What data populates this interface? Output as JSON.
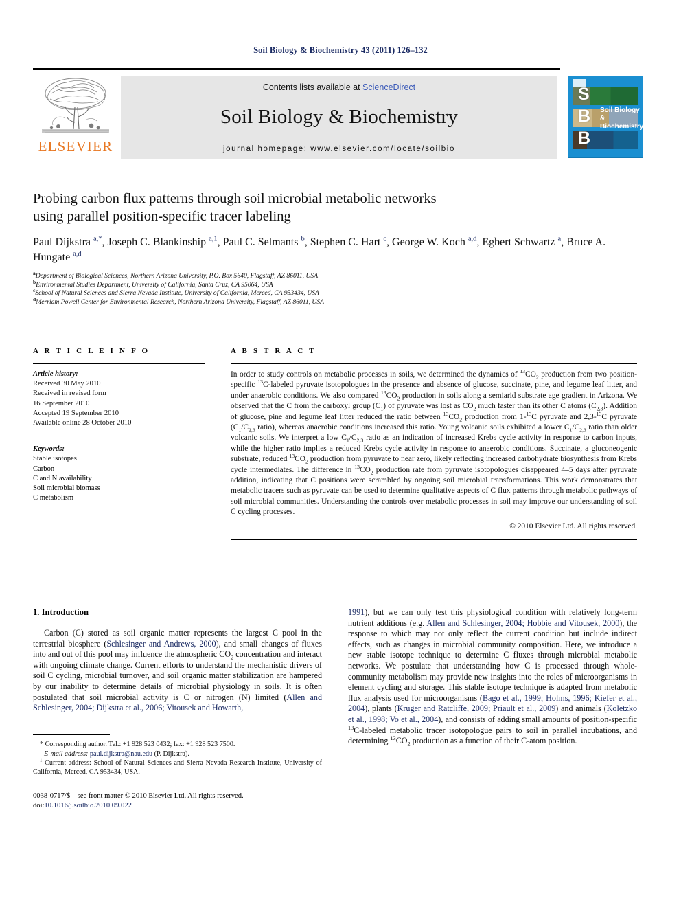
{
  "running_head": "Soil Biology & Biochemistry 43 (2011) 126–132",
  "masthead": {
    "contents_prefix": "Contents lists available at ",
    "sciencedirect": "ScienceDirect",
    "journal_title": "Soil Biology & Biochemistry",
    "homepage": "journal homepage: www.elsevier.com/locate/soilbio",
    "publisher_wordmark": "ELSEVIER",
    "cover": {
      "letters": "S\nB\nB",
      "title_line1": "Soil Biology &",
      "title_line2": "Biochemistry"
    },
    "accent_orange": "#e87722",
    "link_blue": "#3b5ab8",
    "cover_blue": "#1a8fd1"
  },
  "article": {
    "title_line1": "Probing carbon flux patterns through soil microbial metabolic networks",
    "title_line2": "using parallel position-specific tracer labeling",
    "authors_html": "Paul Dijkstra <sup>a,*</sup>, Joseph C. Blankinship <sup>a,1</sup>, Paul C. Selmants <sup>b</sup>, Stephen C. Hart <sup>c</sup>, George W. Koch <sup>a,d</sup>, Egbert Schwartz <sup>a</sup>, Bruce A. Hungate <sup>a,d</sup>",
    "affiliations": [
      {
        "mark": "a",
        "text": "Department of Biological Sciences, Northern Arizona University, P.O. Box 5640, Flagstaff, AZ 86011, USA"
      },
      {
        "mark": "b",
        "text": "Environmental Studies Department, University of California, Santa Cruz, CA 95064, USA"
      },
      {
        "mark": "c",
        "text": "School of Natural Sciences and Sierra Nevada Institute, University of California, Merced, CA 953434, USA"
      },
      {
        "mark": "d",
        "text": "Merriam Powell Center for Environmental Research, Northern Arizona University, Flagstaff, AZ 86011, USA"
      }
    ]
  },
  "article_info": {
    "heading": "A R T I C L E  I N F O",
    "history_label": "Article history:",
    "history": [
      "Received 30 May 2010",
      "Received in revised form",
      "16 September 2010",
      "Accepted 19 September 2010",
      "Available online 28 October 2010"
    ],
    "keywords_label": "Keywords:",
    "keywords": [
      "Stable isotopes",
      "Carbon",
      "C and N availability",
      "Soil microbial biomass",
      "C metabolism"
    ]
  },
  "abstract": {
    "heading": "A B S T R A C T",
    "body_html": "In order to study controls on metabolic processes in soils, we determined the dynamics of <sup>13</sup>CO<sub>2</sub> production from two position-specific <sup>13</sup>C-labeled pyruvate isotopologues in the presence and absence of glucose, succinate, pine, and legume leaf litter, and under anaerobic conditions. We also compared <sup>13</sup>CO<sub>2</sub> production in soils along a semiarid substrate age gradient in Arizona. We observed that the C from the carboxyl group (C<sub>1</sub>) of pyruvate was lost as CO<sub>2</sub> much faster than its other C atoms (C<sub>2,3</sub>). Addition of glucose, pine and legume leaf litter reduced the ratio between <sup>13</sup>CO<sub>2</sub> production from 1-<sup>13</sup>C pyruvate and 2,3-<sup>13</sup>C pyruvate (C<sub>1</sub>/C<sub>2,3</sub> ratio), whereas anaerobic conditions increased this ratio. Young volcanic soils exhibited a lower C<sub>1</sub>/C<sub>2,3</sub> ratio than older volcanic soils. We interpret a low C<sub>1</sub>/C<sub>2,3</sub> ratio as an indication of increased Krebs cycle activity in response to carbon inputs, while the higher ratio implies a reduced Krebs cycle activity in response to anaerobic conditions. Succinate, a gluconeogenic substrate, reduced <sup>13</sup>CO<sub>2</sub> production from pyruvate to near zero, likely reflecting increased carbohydrate biosynthesis from Krebs cycle intermediates. The difference in <sup>13</sup>CO<sub>2</sub> production rate from pyruvate isotopologues disappeared 4–5 days after pyruvate addition, indicating that C positions were scrambled by ongoing soil microbial transformations. This work demonstrates that metabolic tracers such as pyruvate can be used to determine qualitative aspects of C flux patterns through metabolic pathways of soil microbial communities. Understanding the controls over metabolic processes in soil may improve our understanding of soil C cycling processes.",
    "copyright": "© 2010 Elsevier Ltd. All rights reserved."
  },
  "introduction": {
    "heading": "1. Introduction",
    "left_paragraph_html": "Carbon (C) stored as soil organic matter represents the largest C pool in the terrestrial biosphere (<span class=\"cite\">Schlesinger and Andrews, 2000</span>), and small changes of fluxes into and out of this pool may influence the atmospheric CO<sub>2</sub> concentration and interact with ongoing climate change. Current efforts to understand the mechanistic drivers of soil C cycling, microbial turnover, and soil organic matter stabilization are hampered by our inability to determine details of microbial physiology in soils. It is often postulated that soil microbial activity is C or nitrogen (N) limited (<span class=\"cite\">Allen and Schlesinger, 2004; Dijkstra et al., 2006; Vitousek and Howarth,</span>",
    "right_paragraph_html": "<span class=\"cite\">1991</span>), but we can only test this physiological condition with relatively long-term nutrient additions (e.g. <span class=\"cite\">Allen and Schlesinger, 2004; Hobbie and Vitousek, 2000</span>), the response to which may not only reflect the current condition but include indirect effects, such as changes in microbial community composition. Here, we introduce a new stable isotope technique to determine C fluxes through microbial metabolic networks. We postulate that understanding how C is processed through whole-community metabolism may provide new insights into the roles of microorganisms in element cycling and storage. This stable isotope technique is adapted from metabolic flux analysis used for microorganisms (<span class=\"cite\">Bago et al., 1999; Holms, 1996; Kiefer et al., 2004</span>), plants (<span class=\"cite\">Kruger and Ratcliffe, 2009; Priault et al., 2009</span>) and animals (<span class=\"cite\">Koletzko et al., 1998; Vo et al., 2004</span>), and consists of adding small amounts of position-specific <sup>13</sup>C-labeled metabolic tracer isotopologue pairs to soil in parallel incubations, and determining <sup>13</sup>CO<sub>2</sub> production as a function of their C-atom position."
  },
  "footnotes": {
    "corresponding_html": "* Corresponding author. Tel.: +1 928 523 0432; fax: +1 928 523 7500.",
    "email_html": "<span class=\"em\">E-mail address:</span> <span class=\"lk\">paul.dijkstra@nau.edu</span> (P. Dijkstra).",
    "current_address_html": "<sup>1</sup> Current address: School of Natural Sciences and Sierra Nevada Research Institute, University of California, Merced, CA 953434, USA.",
    "issn_html": "0038-0717/$ – see front matter © 2010 Elsevier Ltd. All rights reserved.",
    "doi_html": "doi:<span class=\"lk\">10.1016/j.soilbio.2010.09.022</span>"
  }
}
